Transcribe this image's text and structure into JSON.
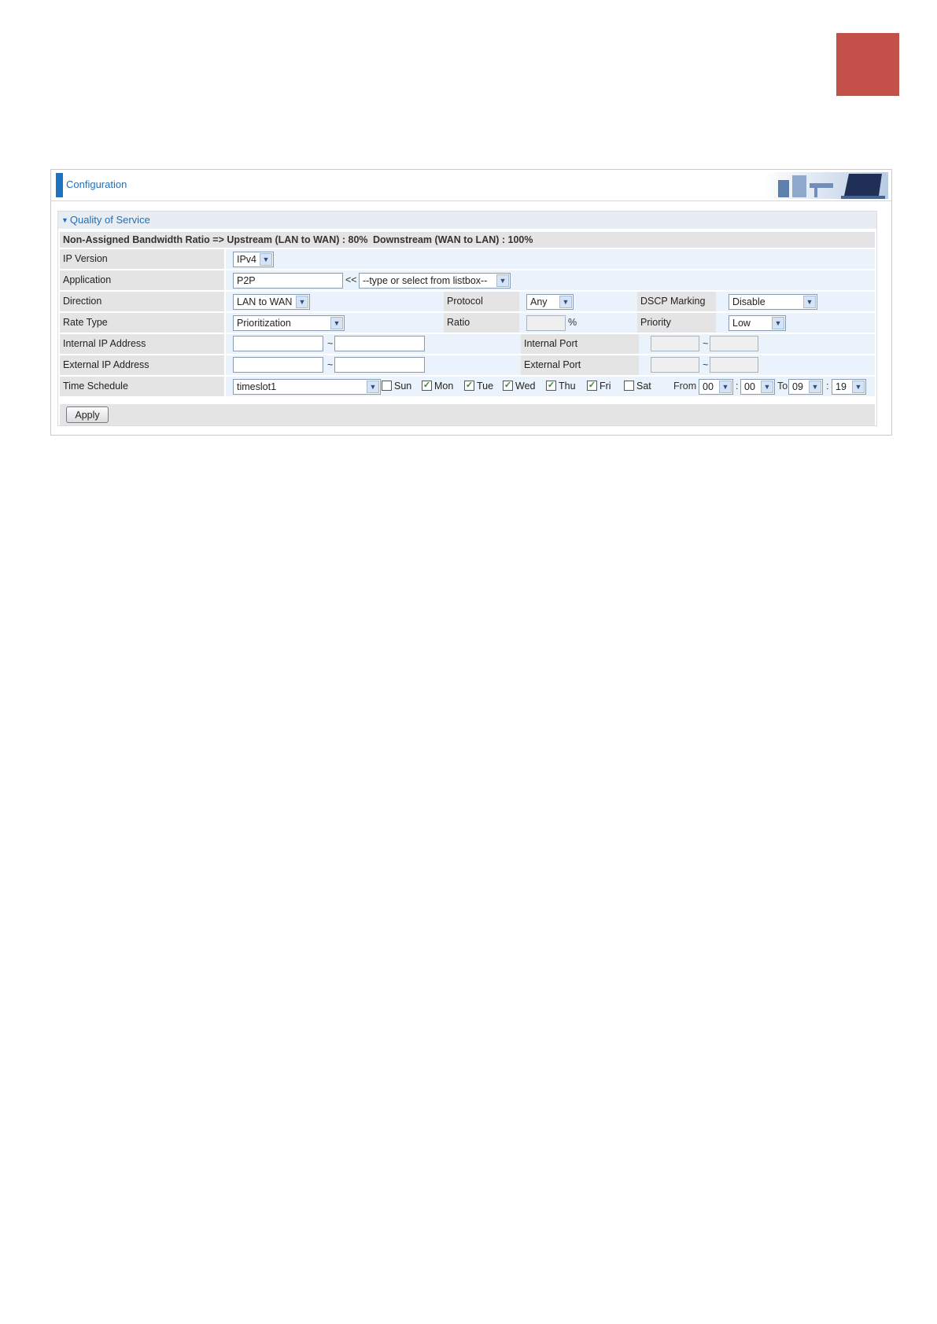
{
  "header": {
    "title": "Configuration"
  },
  "qos": {
    "title": "Quality of Service",
    "bandwidth": {
      "upstream": "Non-Assigned Bandwidth Ratio => Upstream (LAN to WAN) : 80%",
      "downstream": "Downstream (WAN to LAN) : 100%"
    },
    "ip_version": {
      "label": "IP Version",
      "value": "IPv4"
    },
    "application": {
      "label": "Application",
      "value": "P2P",
      "separator": "<<",
      "list_value": "--type or select from listbox--"
    },
    "direction": {
      "label": "Direction",
      "value": "LAN to WAN"
    },
    "protocol": {
      "label": "Protocol",
      "value": "Any"
    },
    "dscp": {
      "label": "DSCP Marking",
      "value": "Disable"
    },
    "rate_type": {
      "label": "Rate Type",
      "value": "Prioritization"
    },
    "ratio": {
      "label": "Ratio",
      "value": "",
      "unit": "%"
    },
    "priority": {
      "label": "Priority",
      "value": "Low"
    },
    "internal_ip": {
      "label": "Internal IP Address",
      "from": "",
      "to": "",
      "tilde": "~"
    },
    "internal_port": {
      "label": "Internal Port",
      "from": "",
      "to": "",
      "tilde": "~"
    },
    "external_ip": {
      "label": "External IP Address",
      "from": "",
      "to": "",
      "tilde": "~"
    },
    "external_port": {
      "label": "External Port",
      "from": "",
      "to": "",
      "tilde": "~"
    },
    "schedule": {
      "label": "Time Schedule",
      "value": "timeslot1",
      "days": [
        {
          "name": "Sun",
          "checked": false
        },
        {
          "name": "Mon",
          "checked": true
        },
        {
          "name": "Tue",
          "checked": true
        },
        {
          "name": "Wed",
          "checked": true
        },
        {
          "name": "Thu",
          "checked": true
        },
        {
          "name": "Fri",
          "checked": true
        },
        {
          "name": "Sat",
          "checked": false
        }
      ],
      "from_label": "From",
      "from_hour": "00",
      "from_min": "00",
      "to_label": "To",
      "to_hour": "09",
      "to_min": "19",
      "colon": ":"
    },
    "apply_label": "Apply"
  }
}
